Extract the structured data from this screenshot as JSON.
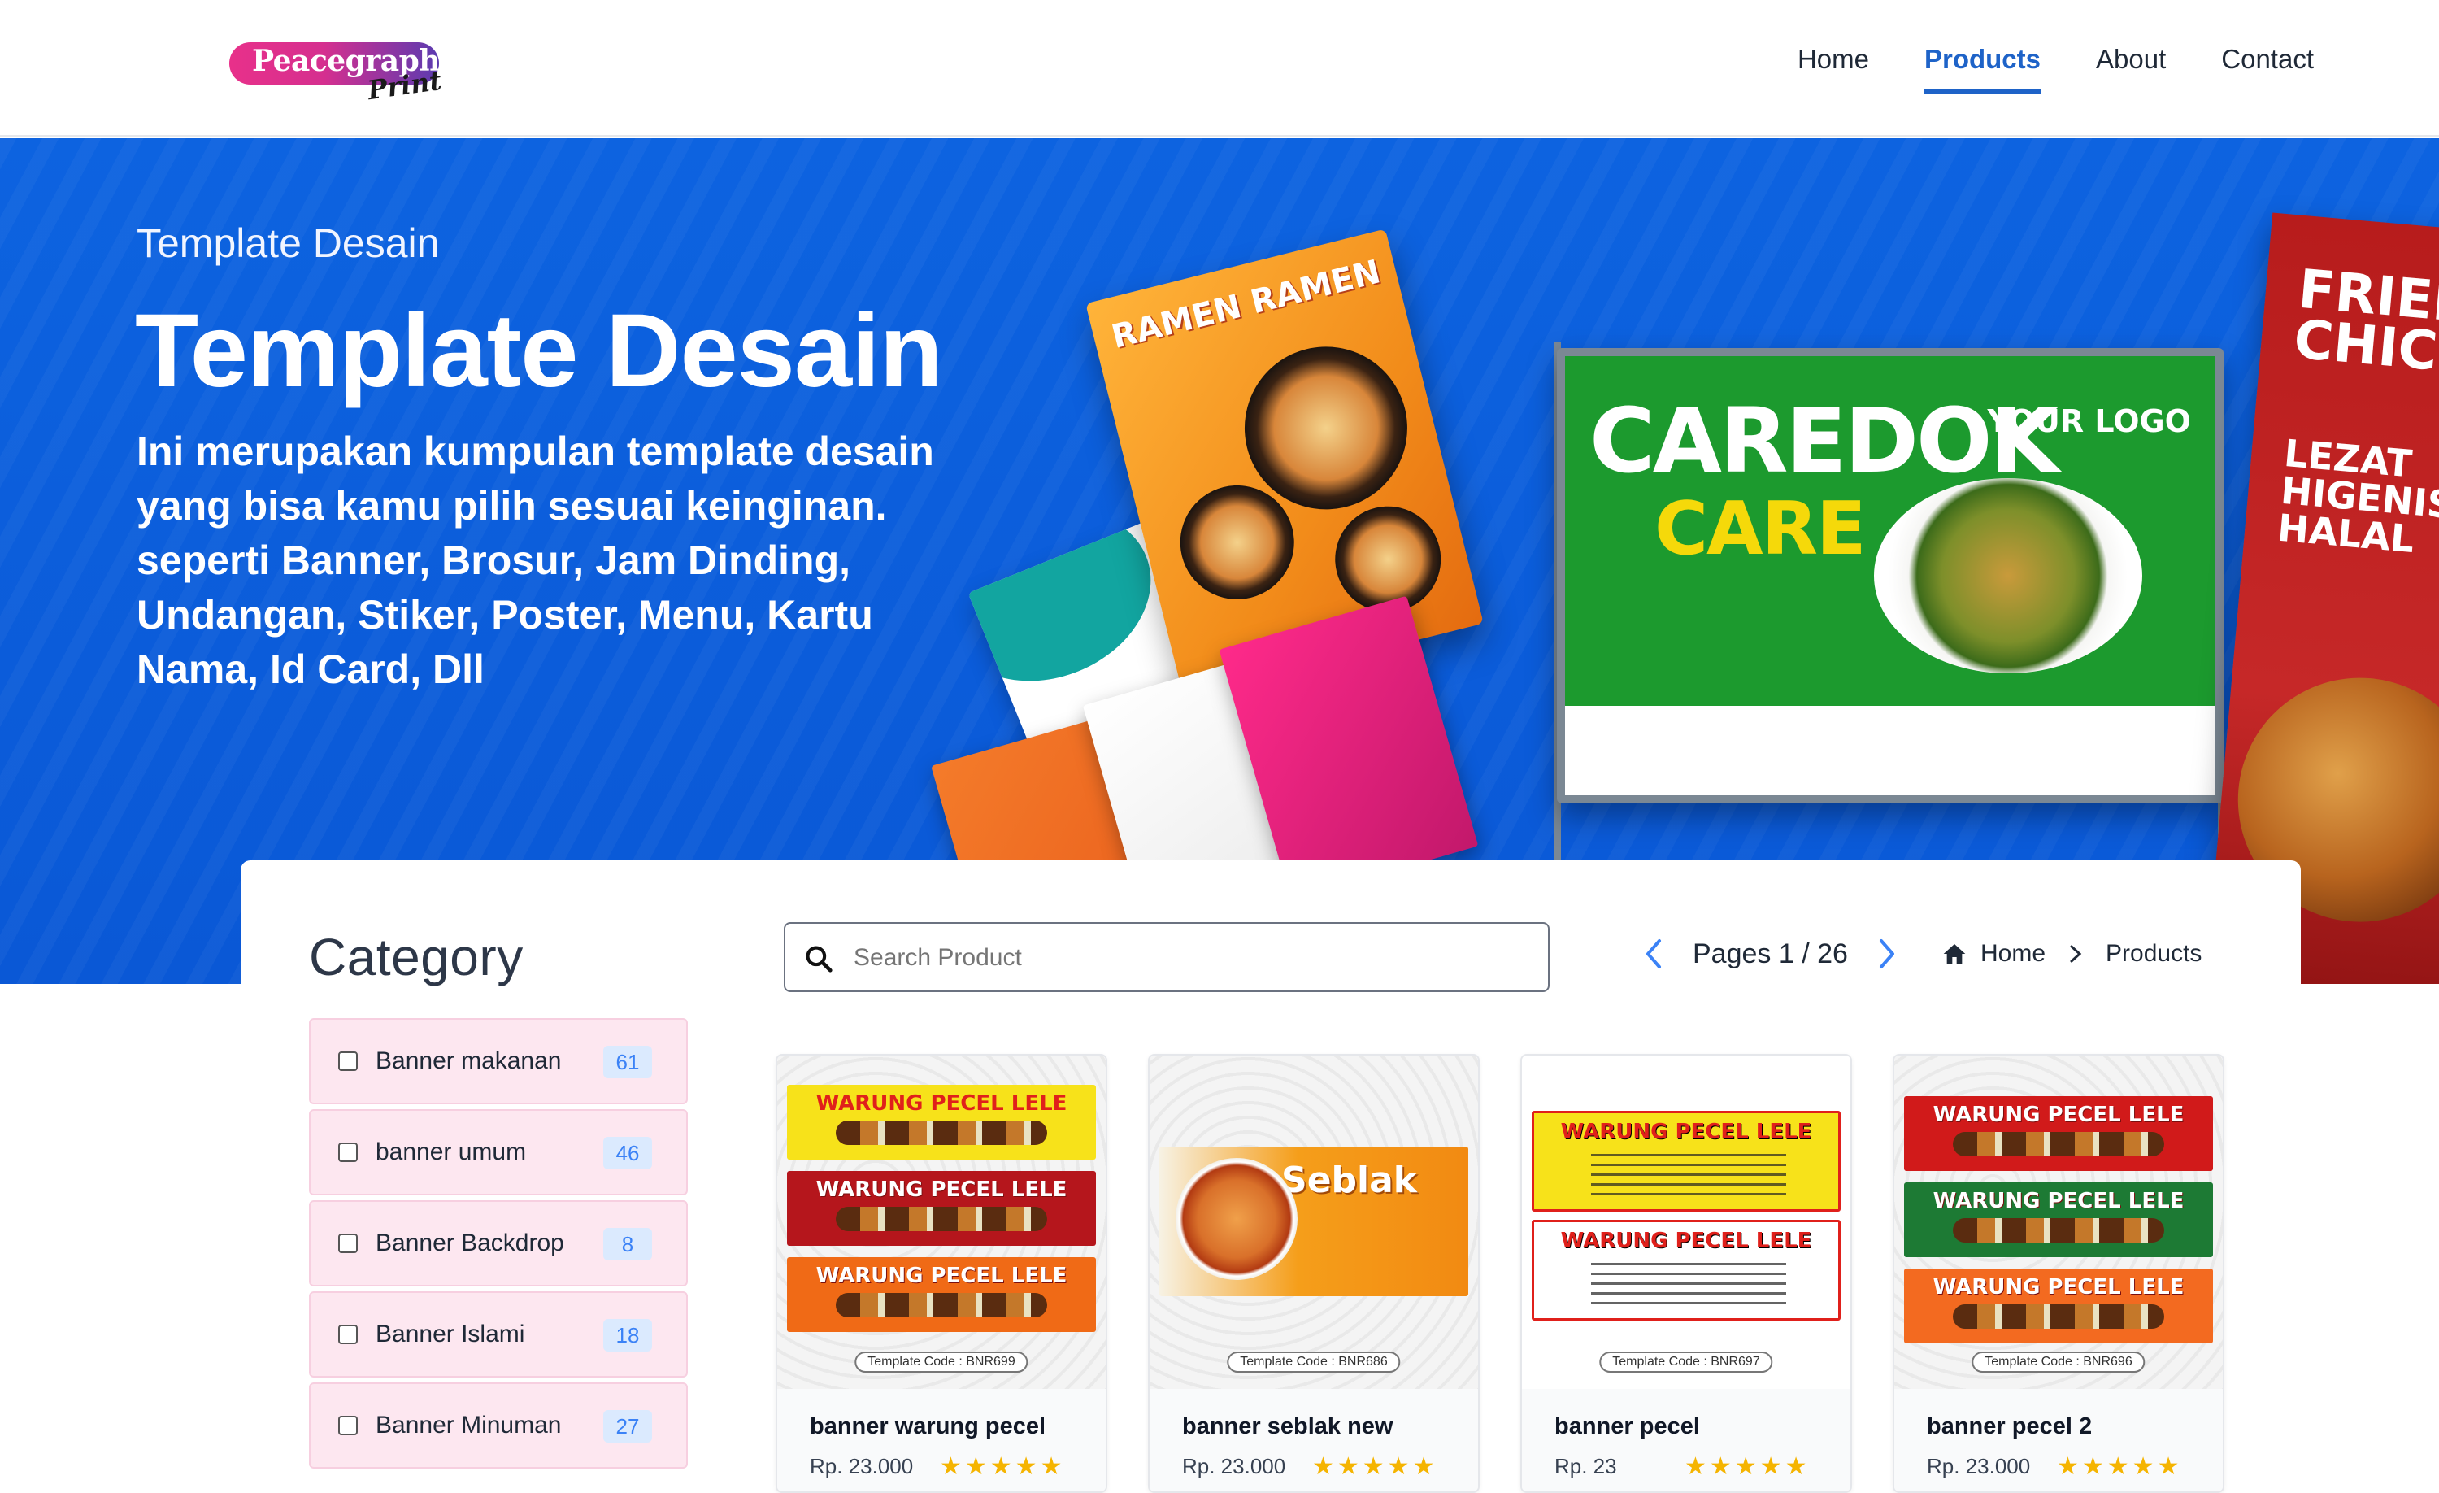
{
  "header": {
    "logo_word": "Peacegraph",
    "logo_script": "Print",
    "nav": [
      {
        "label": "Home",
        "active": false
      },
      {
        "label": "Products",
        "active": true
      },
      {
        "label": "About",
        "active": false
      },
      {
        "label": "Contact",
        "active": false
      }
    ]
  },
  "hero": {
    "eyebrow": "Template Desain",
    "title": "Template Desain",
    "description": "Ini merupakan kumpulan template desain yang bisa kamu pilih sesuai keinginan. seperti Banner, Brosur, Jam Dinding, Undangan, Stiker, Poster, Menu, Kartu Nama, Id Card, Dll",
    "artwork": {
      "flyer_title": "RAMEN RAMEN",
      "banner_title_1": "CAREDOK",
      "banner_title_2": "CARE",
      "banner_logo": "YOUR LOGO",
      "standing_title": "FRIED CHICKEN",
      "standing_tagline": "LEZAT HIGENIS & HALAL"
    }
  },
  "sidebar": {
    "title": "Category",
    "categories": [
      {
        "label": "Banner makanan",
        "count": "61"
      },
      {
        "label": "banner umum",
        "count": "46"
      },
      {
        "label": "Banner Backdrop",
        "count": "8"
      },
      {
        "label": "Banner Islami",
        "count": "18"
      },
      {
        "label": "Banner Minuman",
        "count": "27"
      }
    ]
  },
  "toolbar": {
    "search_placeholder": "Search Product",
    "pages_text": "Pages 1 / 26",
    "breadcrumb": [
      "Home",
      "Products"
    ]
  },
  "products": [
    {
      "name": "banner warung pecel",
      "price": "Rp. 23.000",
      "template_code": "Template Code : BNR699",
      "rating": 5,
      "strip_text": "WARUNG PECEL LELE"
    },
    {
      "name": "banner seblak new",
      "price": "Rp. 23.000",
      "template_code": "Template Code : BNR686",
      "rating": 5,
      "strip_text": "Seblak"
    },
    {
      "name": "banner pecel",
      "price": "Rp. 23",
      "template_code": "Template Code : BNR697",
      "rating": 5,
      "strip_text": "WARUNG PECEL LELE"
    },
    {
      "name": "banner pecel 2",
      "price": "Rp. 23.000",
      "template_code": "Template Code : BNR696",
      "rating": 5,
      "strip_text": "WARUNG PECEL LELE"
    }
  ],
  "colors": {
    "accent": "#1e63c8",
    "hero_bg": "#0d63e0",
    "category_bg": "#fde7f0",
    "star": "#f5b400"
  }
}
